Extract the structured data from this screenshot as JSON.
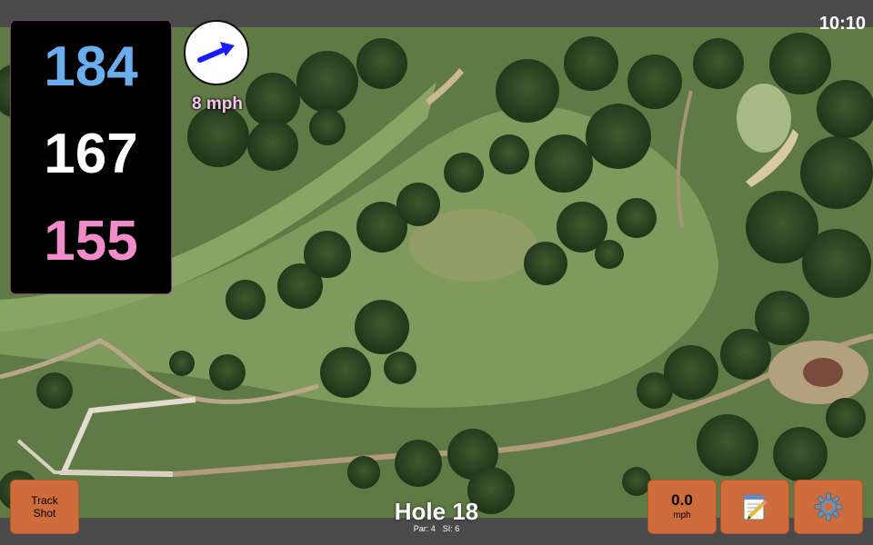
{
  "status_bar": {
    "time": "10:10"
  },
  "distances": {
    "back": "184",
    "middle": "167",
    "front": "155"
  },
  "wind": {
    "speed": "8 mph",
    "icon": "wind-direction-arrow-icon",
    "arrow_color": "#1a1aff"
  },
  "hole": {
    "title": "Hole 18",
    "par": "Par: 4",
    "si": "SI: 6"
  },
  "buttons": {
    "track_shot": "Track\nShot",
    "speed_value": "0.0",
    "speed_unit": "mph",
    "notes_icon": "notepad-pencil-icon",
    "settings_icon": "gear-icon"
  },
  "colors": {
    "accent_button": "#cf6c3c",
    "back_distance": "#6aaef0",
    "middle_distance": "#ffffff",
    "front_distance": "#f08cc8",
    "wind_text": "#f6c6ee"
  }
}
